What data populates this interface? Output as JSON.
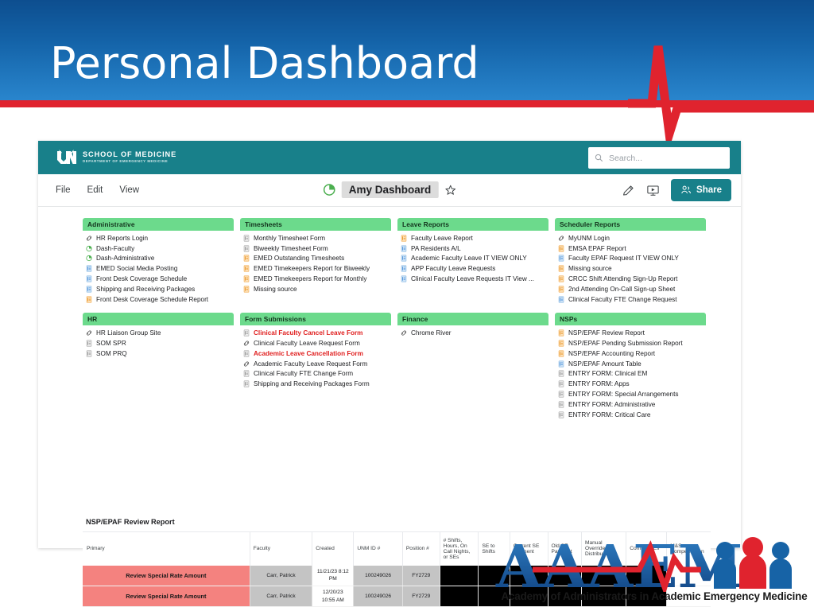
{
  "slide": {
    "title": "Personal Dashboard"
  },
  "app": {
    "logo": {
      "line1": "SCHOOL OF MEDICINE",
      "line2": "DEPARTMENT OF EMERGENCY MEDICINE"
    },
    "search": {
      "placeholder": "Search..."
    },
    "menu": [
      "File",
      "Edit",
      "View"
    ],
    "document_title": "Amy Dashboard",
    "share_label": "Share"
  },
  "cards": [
    [
      {
        "title": "Administrative",
        "items": [
          {
            "label": "HR Reports Login",
            "icon": "link-icon"
          },
          {
            "label": "Dash-Faculty",
            "icon": "pie-icon"
          },
          {
            "label": "Dash-Administrative",
            "icon": "pie-icon"
          },
          {
            "label": "EMED Social Media Posting",
            "icon": "form-blue-icon"
          },
          {
            "label": "Front Desk Coverage Schedule",
            "icon": "form-blue-icon"
          },
          {
            "label": "Shipping and Receiving Packages",
            "icon": "form-blue-icon"
          },
          {
            "label": "Front Desk Coverage Schedule Report",
            "icon": "report-orange-icon"
          }
        ]
      },
      {
        "title": "HR",
        "items": [
          {
            "label": "HR Liaison Group Site",
            "icon": "link-icon"
          },
          {
            "label": "SOM SPR",
            "icon": "form-gray-icon"
          },
          {
            "label": "SOM PRQ",
            "icon": "form-gray-icon"
          }
        ]
      }
    ],
    [
      {
        "title": "Timesheets",
        "items": [
          {
            "label": "Monthly Timesheet Form",
            "icon": "form-gray-icon"
          },
          {
            "label": "Biweekly Timesheet Form",
            "icon": "form-gray-icon"
          },
          {
            "label": "EMED Outstanding Timesheets",
            "icon": "report-orange-icon"
          },
          {
            "label": "EMED Timekeepers Report for Biweekly",
            "icon": "report-orange-icon"
          },
          {
            "label": "EMED Timekeepers Report for Monthly",
            "icon": "report-orange-icon"
          },
          {
            "label": "Missing source",
            "icon": "report-orange-icon"
          }
        ]
      },
      {
        "title": "Form Submissions",
        "items": [
          {
            "label": "Clinical Faculty Cancel Leave Form",
            "icon": "form-gray-icon",
            "red": true
          },
          {
            "label": "Clinical Faculty Leave Request Form",
            "icon": "link-icon"
          },
          {
            "label": "Academic Leave Cancellation Form",
            "icon": "form-gray-icon",
            "red": true
          },
          {
            "label": "Academic Faculty Leave Request Form",
            "icon": "link-icon"
          },
          {
            "label": "Clinical Faculty FTE Change Form",
            "icon": "form-gray-icon"
          },
          {
            "label": "Shipping and Receiving Packages Form",
            "icon": "form-gray-icon"
          }
        ]
      }
    ],
    [
      {
        "title": "Leave Reports",
        "items": [
          {
            "label": "Faculty Leave Report",
            "icon": "report-orange-icon"
          },
          {
            "label": "PA Residents A/L",
            "icon": "form-blue-icon"
          },
          {
            "label": "Academic Faculty Leave IT VIEW ONLY",
            "icon": "form-blue-icon"
          },
          {
            "label": "APP Faculty Leave Requests",
            "icon": "form-blue-icon"
          },
          {
            "label": "Clinical Faculty Leave Requests IT View ...",
            "icon": "form-blue-icon"
          }
        ]
      },
      {
        "title": "Finance",
        "items": [
          {
            "label": "Chrome River",
            "icon": "link-icon"
          }
        ]
      }
    ],
    [
      {
        "title": "Scheduler Reports",
        "items": [
          {
            "label": "MyUNM Login",
            "icon": "link-icon"
          },
          {
            "label": "EMSA EPAF Report",
            "icon": "report-orange-icon"
          },
          {
            "label": "Faculty EPAF Request IT VIEW ONLY",
            "icon": "form-blue-icon"
          },
          {
            "label": "Missing source",
            "icon": "report-orange-icon"
          },
          {
            "label": "CRCC Shift Attending Sign-Up Report",
            "icon": "report-orange-icon"
          },
          {
            "label": "2nd Attending On-Call Sign-up Sheet",
            "icon": "report-orange-icon"
          },
          {
            "label": "Clinical Faculty FTE Change Request",
            "icon": "form-blue-icon"
          }
        ]
      },
      {
        "title": "NSPs",
        "items": [
          {
            "label": "NSP/EPAF Review Report",
            "icon": "report-orange-icon"
          },
          {
            "label": "NSP/EPAF Pending Submission Report",
            "icon": "report-orange-icon"
          },
          {
            "label": "NSP/EPAF Accounting Report",
            "icon": "report-orange-icon"
          },
          {
            "label": "NSP/EPAF Amount Table",
            "icon": "form-blue-icon"
          },
          {
            "label": "ENTRY FORM: Clinical EM",
            "icon": "form-gray-icon"
          },
          {
            "label": "ENTRY FORM: Apps",
            "icon": "form-gray-icon"
          },
          {
            "label": "ENTRY FORM: Special Arrangements",
            "icon": "form-gray-icon"
          },
          {
            "label": "ENTRY FORM: Administrative",
            "icon": "form-gray-icon"
          },
          {
            "label": "ENTRY FORM: Critical Care",
            "icon": "form-gray-icon"
          }
        ]
      }
    ]
  ],
  "table": {
    "title": "NSP/EPAF Review Report",
    "columns": [
      "Primary",
      "Faculty",
      "Created",
      "UNM ID #",
      "Position #",
      "# Shifts, Hours, On Call Nights, or SEs",
      "SE to Shifts",
      "Current SE Payment",
      "Old SE Payment",
      "Manual Override SE Distribution",
      "Confirm SEs",
      "M&S or Compensation"
    ],
    "rows": [
      {
        "primary": "Review Special Rate Amount",
        "faculty": "Carr, Patrick",
        "created": "11/21/23 8:12 PM",
        "unm_id": "100249026",
        "position": "FY2729",
        "redacted": [
          "",
          "",
          "",
          "",
          "",
          ""
        ],
        "last": ""
      },
      {
        "primary": "Review Special Rate Amount",
        "faculty": "Carr, Patrick",
        "created": "12/20/23 10:55 AM",
        "unm_id": "100249026",
        "position": "FY2729",
        "redacted": [
          "",
          "",
          "",
          "",
          "",
          ""
        ],
        "last": ""
      }
    ]
  },
  "footer_logo": {
    "acronym": "AAAEM",
    "tagline": "Academy of Administrators in Academic Emergency Medicine"
  },
  "colors": {
    "header_blue": "#1463a8",
    "accent_red": "#e0232e",
    "app_teal": "#18808a",
    "card_green": "#6cda8c",
    "row_red": "#f4827f",
    "link_red": "#e02020"
  }
}
